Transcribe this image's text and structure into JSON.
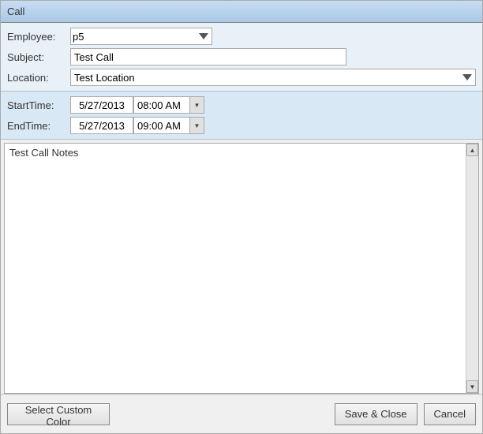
{
  "window": {
    "title": "Call"
  },
  "form": {
    "employee_label": "Employee:",
    "employee_value": "p5",
    "subject_label": "Subject:",
    "subject_value": "Test Call",
    "location_label": "Location:",
    "location_value": "Test Location"
  },
  "times": {
    "start_label": "StartTime:",
    "start_date": "5/27/2013",
    "start_time": "08:00 AM",
    "end_label": "EndTime:",
    "end_date": "5/27/2013",
    "end_time": "09:00 AM"
  },
  "notes": {
    "value": "Test Call Notes"
  },
  "buttons": {
    "custom_color": "Select Custom Color",
    "save_close": "Save & Close",
    "cancel": "Cancel"
  },
  "icons": {
    "dropdown_arrow": "▼",
    "scroll_up": "▲",
    "scroll_down": "▼"
  }
}
